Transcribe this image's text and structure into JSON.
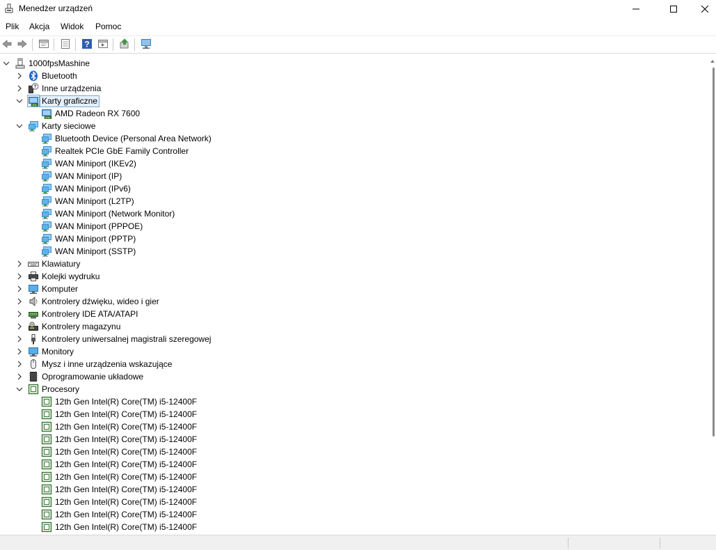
{
  "window": {
    "title": "Menedżer urządzeń",
    "minimize_icon": "minimize-icon",
    "maximize_icon": "maximize-icon",
    "close_icon": "close-icon"
  },
  "menu": [
    "Plik",
    "Akcja",
    "Widok",
    "Pomoc"
  ],
  "toolbar": [
    "back-icon",
    "forward-icon",
    "properties-icon",
    "show-hidden-icon",
    "help-icon",
    "action-icon",
    "update-driver-icon",
    "scan-hardware-icon"
  ],
  "colors": {
    "selection_bg": "#e5f1fb",
    "selection_border": "#7aa7d6",
    "network_icon": "#3d8fd1",
    "cpu_icon": "#3c7a3c"
  },
  "tree": {
    "root": {
      "label": "1000fpsMashine",
      "expanded": true,
      "icon": "computer-icon"
    },
    "nodes": [
      {
        "label": "Bluetooth",
        "expanded": false,
        "icon": "bluetooth-icon"
      },
      {
        "label": "Inne urządzenia",
        "expanded": false,
        "icon": "unknown-device-icon"
      },
      {
        "label": "Karty graficzne",
        "expanded": true,
        "selected": true,
        "icon": "display-adapter-icon",
        "children": [
          {
            "label": "AMD Radeon RX 7600",
            "icon": "display-adapter-icon"
          }
        ]
      },
      {
        "label": "Karty sieciowe",
        "expanded": true,
        "icon": "network-adapter-icon",
        "children": [
          {
            "label": "Bluetooth Device (Personal Area Network)",
            "icon": "network-adapter-icon"
          },
          {
            "label": "Realtek PCIe GbE Family Controller",
            "icon": "network-adapter-icon"
          },
          {
            "label": "WAN Miniport (IKEv2)",
            "icon": "network-adapter-icon"
          },
          {
            "label": "WAN Miniport (IP)",
            "icon": "network-adapter-icon"
          },
          {
            "label": "WAN Miniport (IPv6)",
            "icon": "network-adapter-icon"
          },
          {
            "label": "WAN Miniport (L2TP)",
            "icon": "network-adapter-icon"
          },
          {
            "label": "WAN Miniport (Network Monitor)",
            "icon": "network-adapter-icon"
          },
          {
            "label": "WAN Miniport (PPPOE)",
            "icon": "network-adapter-icon"
          },
          {
            "label": "WAN Miniport (PPTP)",
            "icon": "network-adapter-icon"
          },
          {
            "label": "WAN Miniport (SSTP)",
            "icon": "network-adapter-icon"
          }
        ]
      },
      {
        "label": "Klawiatury",
        "expanded": false,
        "icon": "keyboard-icon"
      },
      {
        "label": "Kolejki wydruku",
        "expanded": false,
        "icon": "printer-icon"
      },
      {
        "label": "Komputer",
        "expanded": false,
        "icon": "monitor-computer-icon"
      },
      {
        "label": "Kontrolery dźwięku, wideo i gier",
        "expanded": false,
        "icon": "speaker-icon"
      },
      {
        "label": "Kontrolery IDE ATA/ATAPI",
        "expanded": false,
        "icon": "ide-controller-icon"
      },
      {
        "label": "Kontrolery magazynu",
        "expanded": false,
        "icon": "storage-controller-icon"
      },
      {
        "label": "Kontrolery uniwersalnej magistrali szeregowej",
        "expanded": false,
        "icon": "usb-icon"
      },
      {
        "label": "Monitory",
        "expanded": false,
        "icon": "monitor-icon"
      },
      {
        "label": "Mysz i inne urządzenia wskazujące",
        "expanded": false,
        "icon": "mouse-icon"
      },
      {
        "label": "Oprogramowanie układowe",
        "expanded": false,
        "icon": "firmware-icon"
      },
      {
        "label": "Procesory",
        "expanded": true,
        "icon": "cpu-icon",
        "children": [
          {
            "label": "12th Gen Intel(R) Core(TM) i5-12400F",
            "icon": "cpu-icon"
          },
          {
            "label": "12th Gen Intel(R) Core(TM) i5-12400F",
            "icon": "cpu-icon"
          },
          {
            "label": "12th Gen Intel(R) Core(TM) i5-12400F",
            "icon": "cpu-icon"
          },
          {
            "label": "12th Gen Intel(R) Core(TM) i5-12400F",
            "icon": "cpu-icon"
          },
          {
            "label": "12th Gen Intel(R) Core(TM) i5-12400F",
            "icon": "cpu-icon"
          },
          {
            "label": "12th Gen Intel(R) Core(TM) i5-12400F",
            "icon": "cpu-icon"
          },
          {
            "label": "12th Gen Intel(R) Core(TM) i5-12400F",
            "icon": "cpu-icon"
          },
          {
            "label": "12th Gen Intel(R) Core(TM) i5-12400F",
            "icon": "cpu-icon"
          },
          {
            "label": "12th Gen Intel(R) Core(TM) i5-12400F",
            "icon": "cpu-icon"
          },
          {
            "label": "12th Gen Intel(R) Core(TM) i5-12400F",
            "icon": "cpu-icon"
          },
          {
            "label": "12th Gen Intel(R) Core(TM) i5-12400F",
            "icon": "cpu-icon"
          }
        ]
      }
    ]
  }
}
